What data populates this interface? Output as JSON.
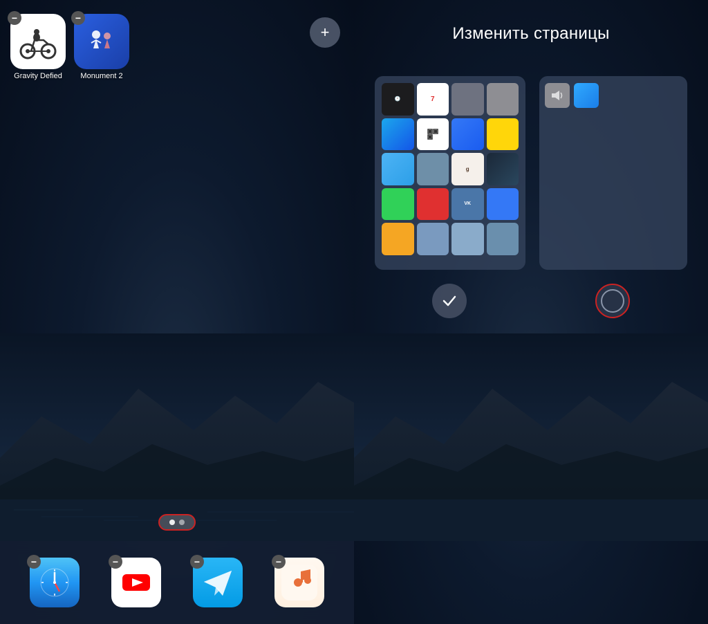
{
  "left": {
    "apps": [
      {
        "id": "gravity-defied",
        "label": "Gravity Defied",
        "type": "gravity"
      },
      {
        "id": "monument",
        "label": "Monument 2",
        "type": "monument"
      }
    ],
    "addButton": "+",
    "dots": [
      true,
      false
    ],
    "dock": [
      {
        "id": "safari",
        "type": "safari"
      },
      {
        "id": "youtube",
        "type": "youtube"
      },
      {
        "id": "telegram",
        "type": "telegram"
      },
      {
        "id": "scrobbler",
        "type": "scrobbler"
      }
    ]
  },
  "right": {
    "title": "Изменить страницы",
    "pages": [
      {
        "id": "main-page",
        "hasCheck": true
      },
      {
        "id": "second-page",
        "hasCircle": true
      }
    ]
  }
}
